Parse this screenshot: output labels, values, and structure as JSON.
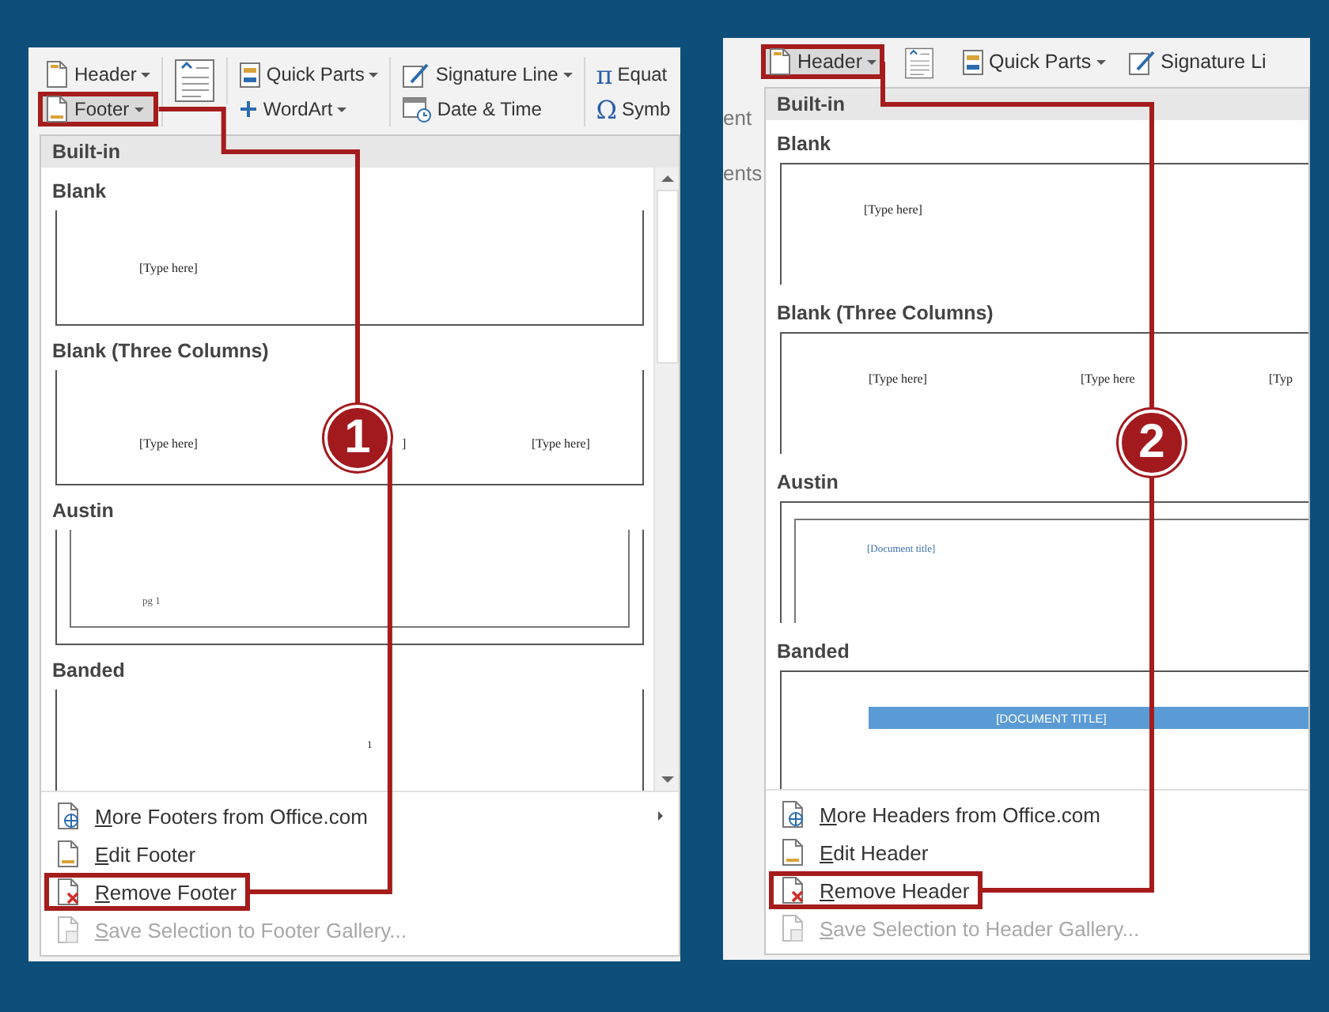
{
  "panels": [
    {
      "number": "1",
      "scrollbar": true,
      "ribbon": [
        {
          "items": [
            {
              "kind": "header",
              "label": "Header",
              "dropdown": true,
              "highlighted": false
            },
            {
              "kind": "footer",
              "label": "Footer",
              "dropdown": true,
              "highlighted": true
            }
          ]
        },
        {
          "items": [
            {
              "kind": "textbox",
              "dropdown": false,
              "highlighted": false
            }
          ]
        },
        {
          "items": [
            {
              "kind": "quickparts",
              "label": "Quick Parts",
              "dropdown": true,
              "highlighted": false
            },
            {
              "kind": "wordart",
              "label": "WordArt",
              "dropdown": true,
              "highlighted": false
            }
          ]
        },
        {
          "items": [
            {
              "kind": "signature",
              "label": "Signature Line",
              "dropdown": true,
              "highlighted": false
            },
            {
              "kind": "datetime",
              "label": "Date & Time",
              "dropdown": false,
              "highlighted": false
            }
          ]
        },
        {
          "items": [
            {
              "kind": "equation",
              "glyph": "π",
              "label": "Equat",
              "dropdown": false,
              "highlighted": false
            },
            {
              "kind": "symbol",
              "glyph": "Ω",
              "label": "Symb",
              "dropdown": false,
              "highlighted": false
            }
          ]
        }
      ],
      "gallery": {
        "heading": "Built-in",
        "kind": "footer",
        "sections": [
          {
            "title": "Blank",
            "kind": "blank",
            "texts": [
              "[Type here]"
            ]
          },
          {
            "title": "Blank (Three Columns)",
            "kind": "three_columns",
            "texts": [
              "[Type here]",
              "]",
              "[Type here]"
            ]
          },
          {
            "title": "Austin",
            "kind": "austin",
            "texts": [
              "pg 1"
            ]
          },
          {
            "title": "Banded",
            "kind": "banded",
            "texts": [
              "1"
            ]
          }
        ]
      },
      "menu": [
        {
          "kind": "globe",
          "label": "More Footers from Office.com",
          "submenu": true,
          "disabled": false,
          "highlighted": false
        },
        {
          "kind": "edit",
          "label": "Edit Footer",
          "submenu": false,
          "disabled": false,
          "highlighted": false
        },
        {
          "kind": "remove",
          "label": "Remove Footer",
          "submenu": false,
          "disabled": false,
          "highlighted": true
        },
        {
          "kind": "save",
          "label": "Save Selection to Footer Gallery...",
          "submenu": false,
          "disabled": true,
          "highlighted": false
        }
      ]
    },
    {
      "number": "2",
      "scrollbar": false,
      "doc_fragments": [
        "ent",
        "ents"
      ],
      "ribbon": [
        {
          "items": [
            {
              "kind": "header",
              "label": "Header",
              "dropdown": true,
              "highlighted": true
            }
          ]
        },
        {
          "items": [
            {
              "kind": "textbox",
              "dropdown": false,
              "highlighted": false
            }
          ]
        },
        {
          "items": [
            {
              "kind": "quickparts",
              "label": "Quick Parts",
              "dropdown": true,
              "highlighted": false
            }
          ]
        },
        {
          "items": [
            {
              "kind": "signature",
              "label": "Signature Li",
              "dropdown": false,
              "highlighted": false
            }
          ]
        }
      ],
      "gallery": {
        "heading": "Built-in",
        "kind": "header",
        "sections": [
          {
            "title": "Blank",
            "kind": "blank",
            "texts": [
              "[Type here]"
            ]
          },
          {
            "title": "Blank (Three Columns)",
            "kind": "three_columns",
            "texts": [
              "[Type here]",
              "[Type here",
              "[Typ"
            ]
          },
          {
            "title": "Austin",
            "kind": "austin",
            "texts": [
              "[Document title]"
            ]
          },
          {
            "title": "Banded",
            "kind": "banded",
            "texts": [
              "[DOCUMENT TITLE]"
            ]
          }
        ]
      },
      "menu": [
        {
          "kind": "globe",
          "label": "More Headers from Office.com",
          "submenu": false,
          "disabled": false,
          "highlighted": false
        },
        {
          "kind": "edit",
          "label": "Edit Header",
          "submenu": false,
          "disabled": false,
          "highlighted": false
        },
        {
          "kind": "remove",
          "label": "Remove Header",
          "submenu": false,
          "disabled": false,
          "highlighted": true
        },
        {
          "kind": "save",
          "label": "Save Selection to Header Gallery...",
          "submenu": false,
          "disabled": true,
          "highlighted": false
        }
      ]
    }
  ]
}
